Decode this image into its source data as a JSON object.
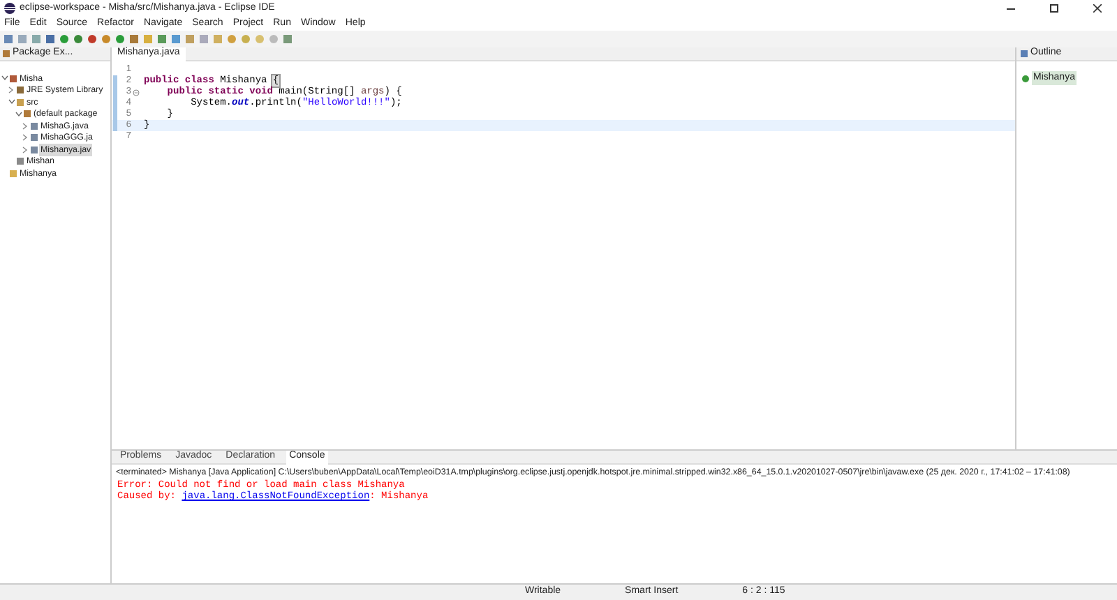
{
  "window": {
    "title": "eclipse-workspace - Misha/src/Mishanya.java - Eclipse IDE"
  },
  "menu": [
    "File",
    "Edit",
    "Source",
    "Refactor",
    "Navigate",
    "Search",
    "Project",
    "Run",
    "Window",
    "Help"
  ],
  "explorer": {
    "title": "Package Ex...",
    "tree": [
      {
        "label": "Misha",
        "kind": "project",
        "expanded": true,
        "selected": false,
        "children": [
          {
            "label": "JRE System Library",
            "kind": "library",
            "expanded": false,
            "selected": false
          },
          {
            "label": "src",
            "kind": "folder",
            "expanded": true,
            "selected": false,
            "children": [
              {
                "label": "(default package",
                "kind": "package",
                "expanded": true,
                "selected": false,
                "children": [
                  {
                    "label": "MishaG.java",
                    "kind": "file",
                    "expanded": false,
                    "selected": false
                  },
                  {
                    "label": "MishaGGG.ja",
                    "kind": "file",
                    "expanded": false,
                    "selected": false
                  },
                  {
                    "label": "Mishanya.jav",
                    "kind": "file",
                    "expanded": false,
                    "selected": true
                  }
                ]
              }
            ]
          },
          {
            "label": "Mishan",
            "kind": "class",
            "selected": false
          }
        ]
      },
      {
        "label": "Mishanya",
        "kind": "dir",
        "selected": false
      }
    ]
  },
  "editor": {
    "tab": "Mishanya.java",
    "lines": [
      {
        "number": "1",
        "current": false
      },
      {
        "number": "2",
        "tokens": [
          {
            "text": "public class ",
            "kind": "keyword"
          },
          {
            "text": "Mishanya ",
            "kind": "plain"
          },
          {
            "text": "{",
            "kind": "bracket"
          }
        ]
      },
      {
        "number": "3",
        "fold": true,
        "tokens": [
          {
            "text": "    public static void ",
            "kind": "keyword"
          },
          {
            "text": "main(String[] ",
            "kind": "plain"
          },
          {
            "text": "args",
            "kind": "param"
          },
          {
            "text": ") {",
            "kind": "plain"
          }
        ]
      },
      {
        "number": "4",
        "tokens": [
          {
            "text": "        System.",
            "kind": "plain"
          },
          {
            "text": "out",
            "kind": "field"
          },
          {
            "text": ".println(",
            "kind": "plain"
          },
          {
            "text": "\"HelloWorld!!!\"",
            "kind": "string"
          },
          {
            "text": ");",
            "kind": "plain"
          }
        ]
      },
      {
        "number": "5",
        "tokens": [
          {
            "text": "    }",
            "kind": "plain"
          }
        ]
      },
      {
        "number": "6",
        "current": true,
        "tokens": [
          {
            "text": "}",
            "kind": "plain"
          }
        ]
      },
      {
        "number": "7",
        "current": false
      }
    ]
  },
  "outline": {
    "title": "Outline",
    "items": [
      {
        "label": "Mishanya",
        "selected": true
      }
    ]
  },
  "bottom": {
    "tabs": [
      {
        "label": "Problems",
        "selected": false
      },
      {
        "label": "Javadoc",
        "selected": false
      },
      {
        "label": "Declaration",
        "selected": false
      },
      {
        "label": "Console",
        "selected": true
      }
    ],
    "header": "<terminated> Mishanya [Java Application] C:\\Users\\buben\\AppData\\Local\\Temp\\eoiD31A.tmp\\plugins\\org.eclipse.justj.openjdk.hotspot.jre.minimal.stripped.win32.x86_64_15.0.1.v20201027-0507\\jre\\bin\\javaw.exe  (25 дек. 2020 г., 17:41:02 – 17:41:08)",
    "lines": [
      {
        "kind": "error",
        "text": "Error: Could not find or load main class Mishanya"
      },
      {
        "kind": "caused",
        "prefix": "Caused by: ",
        "link": "java.lang.ClassNotFoundException",
        "suffix": ": Mishanya"
      }
    ]
  },
  "status_bar": [
    "Writable",
    "Smart Insert",
    "6 : 2 : 115"
  ]
}
